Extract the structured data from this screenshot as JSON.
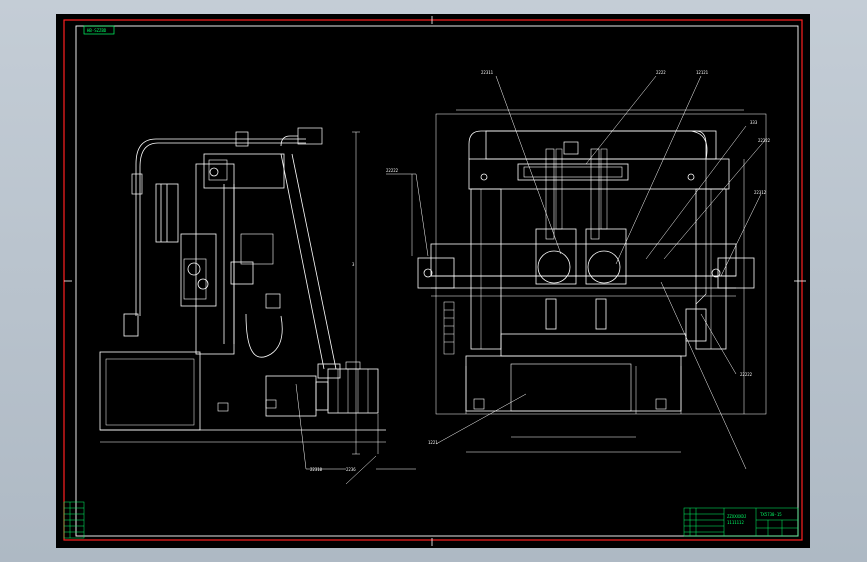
{
  "drawing": {
    "corner_tag": "HB-SZZBD",
    "colors": {
      "background": "#000000",
      "frame": "#ff2020",
      "lines": "#ffffff",
      "title_block": "#00ff66",
      "workspace": "#b9c3cd"
    },
    "callouts_left": [
      "22310",
      "2236",
      "3"
    ],
    "callouts_right": [
      "22311",
      "2222",
      "12121",
      "333",
      "22222",
      "22312",
      "22222",
      "1221",
      "22222"
    ],
    "title_block": {
      "drawing_name": "TX5730-15",
      "company_line1": "ZZXXXXDJ",
      "company_line2": "1111112"
    }
  }
}
